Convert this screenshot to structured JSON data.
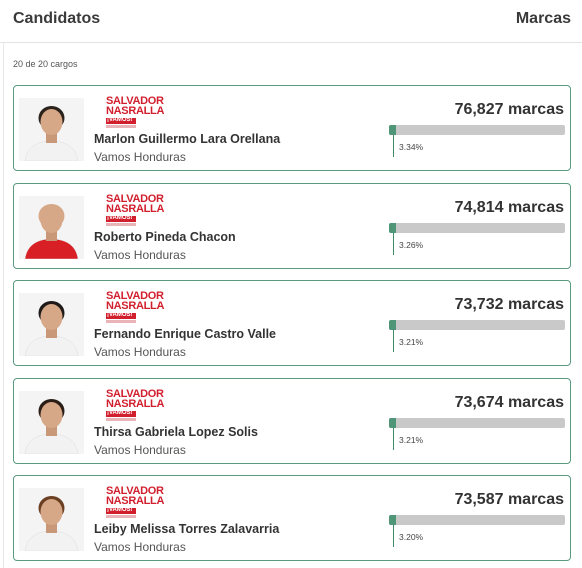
{
  "header": {
    "title": "Candidatos",
    "column": "Marcas"
  },
  "results_count": "20 de 20 cargos",
  "logo": {
    "line1": "SALVADOR",
    "line2": "NASRALLA",
    "line3": "¡VAMOS!"
  },
  "candidates": [
    {
      "name": "Marlon Guillermo Lara Orellana",
      "party": "Vamos Honduras",
      "votes": "76,827 marcas",
      "percent_label": "3.34%",
      "percent": 3.34,
      "shirt_color": "#f2f2f2"
    },
    {
      "name": "Roberto Pineda Chacon",
      "party": "Vamos Honduras",
      "votes": "74,814 marcas",
      "percent_label": "3.26%",
      "percent": 3.26,
      "shirt_color": "#d81f26"
    },
    {
      "name": "Fernando Enrique Castro Valle",
      "party": "Vamos Honduras",
      "votes": "73,732 marcas",
      "percent_label": "3.21%",
      "percent": 3.21,
      "shirt_color": "#f2f2f2"
    },
    {
      "name": "Thirsa Gabriela Lopez Solis",
      "party": "Vamos Honduras",
      "votes": "73,674 marcas",
      "percent_label": "3.21%",
      "percent": 3.21,
      "shirt_color": "#f2f2f2"
    },
    {
      "name": "Leiby Melissa Torres Zalavarria",
      "party": "Vamos Honduras",
      "votes": "73,587 marcas",
      "percent_label": "3.20%",
      "percent": 3.2,
      "shirt_color": "#f2f2f2"
    }
  ],
  "colors": {
    "accent": "#4f9678",
    "card_border": "#5c9a80",
    "brand_red": "#d21f2e",
    "bar_track": "#c9c9c9"
  }
}
